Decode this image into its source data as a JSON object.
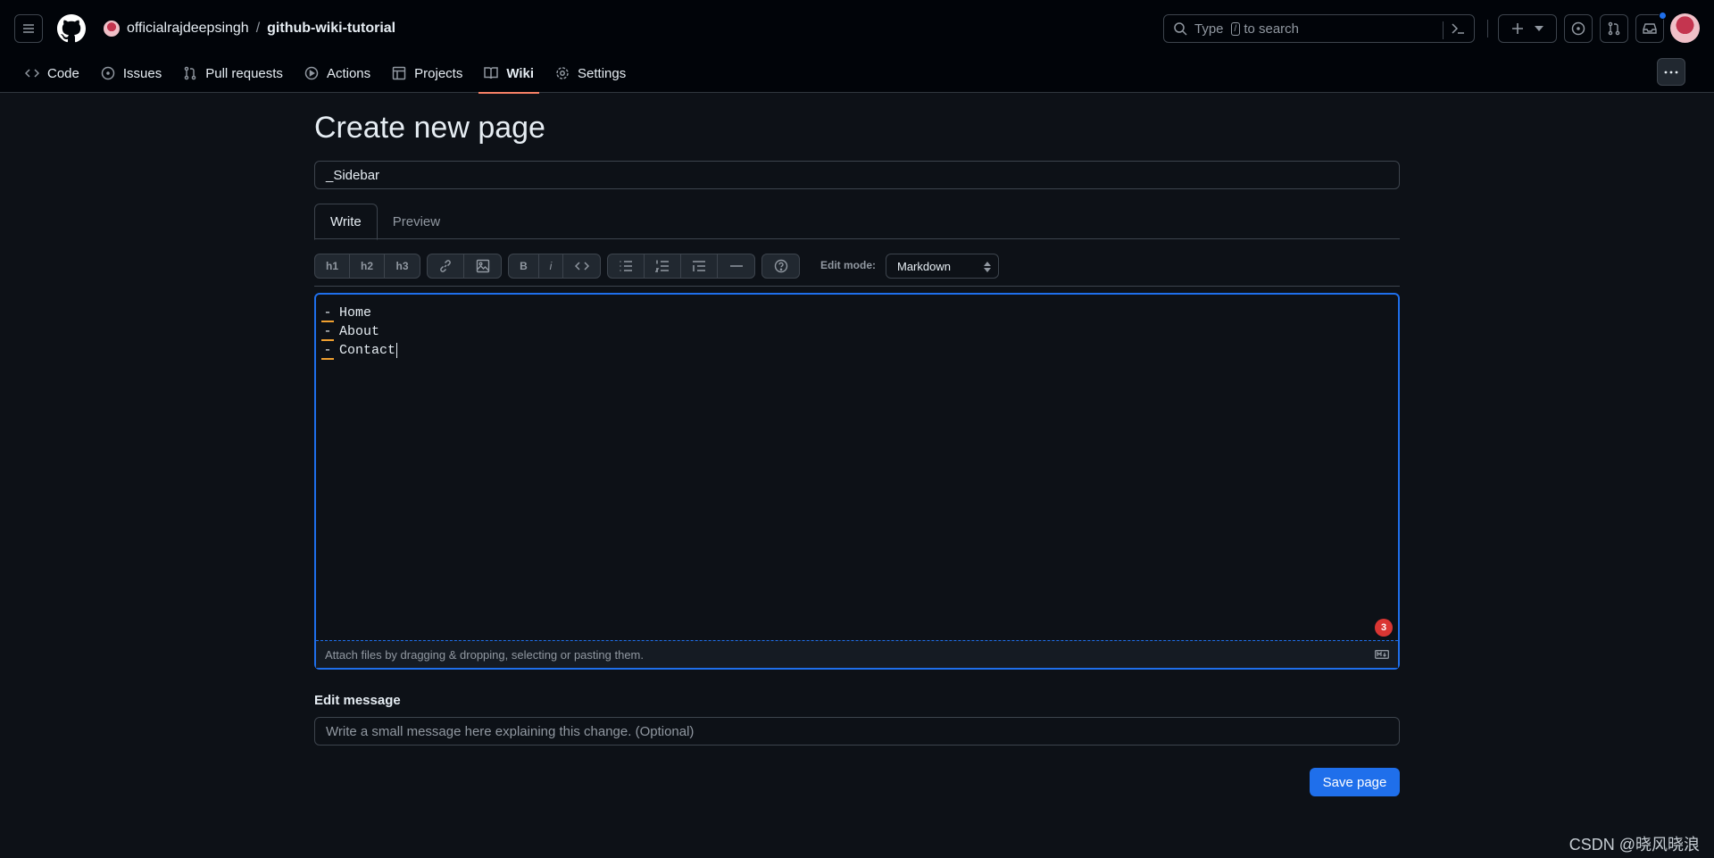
{
  "header": {
    "owner": "officialrajdeepsingh",
    "separator": "/",
    "repo": "github-wiki-tutorial",
    "search_prefix": "Type",
    "search_key": "/",
    "search_suffix": "to search",
    "notification_dot_color": "#1f6feb"
  },
  "nav": {
    "tabs": [
      {
        "label": "Code",
        "icon": "code-icon"
      },
      {
        "label": "Issues",
        "icon": "issue-icon"
      },
      {
        "label": "Pull requests",
        "icon": "pull-request-icon"
      },
      {
        "label": "Actions",
        "icon": "play-icon"
      },
      {
        "label": "Projects",
        "icon": "table-icon"
      },
      {
        "label": "Wiki",
        "icon": "book-icon",
        "selected": true
      },
      {
        "label": "Settings",
        "icon": "gear-icon"
      }
    ]
  },
  "page": {
    "title": "Create new page",
    "page_name_value": "_Sidebar",
    "editor_tabs": [
      "Write",
      "Preview"
    ],
    "toolbar": {
      "h1": "h1",
      "h2": "h2",
      "h3": "h3",
      "bold": "B",
      "italic": "i",
      "edit_mode_label": "Edit mode:",
      "edit_mode_value": "Markdown"
    },
    "content_lines": [
      {
        "marker": "-",
        "text": "Home"
      },
      {
        "marker": "-",
        "text": "About"
      },
      {
        "marker": "-",
        "text": "Contact"
      }
    ],
    "badge_count": "3",
    "attach_hint": "Attach files by dragging & dropping, selecting or pasting them.",
    "edit_message_label": "Edit message",
    "edit_message_placeholder": "Write a small message here explaining this change. (Optional)",
    "save_label": "Save page"
  },
  "watermark": "CSDN @晓风晓浪",
  "colors": {
    "accent": "#1f6feb",
    "tab_underline": "#f78166",
    "markdown_marker": "#f0a030",
    "badge": "#da3633"
  }
}
